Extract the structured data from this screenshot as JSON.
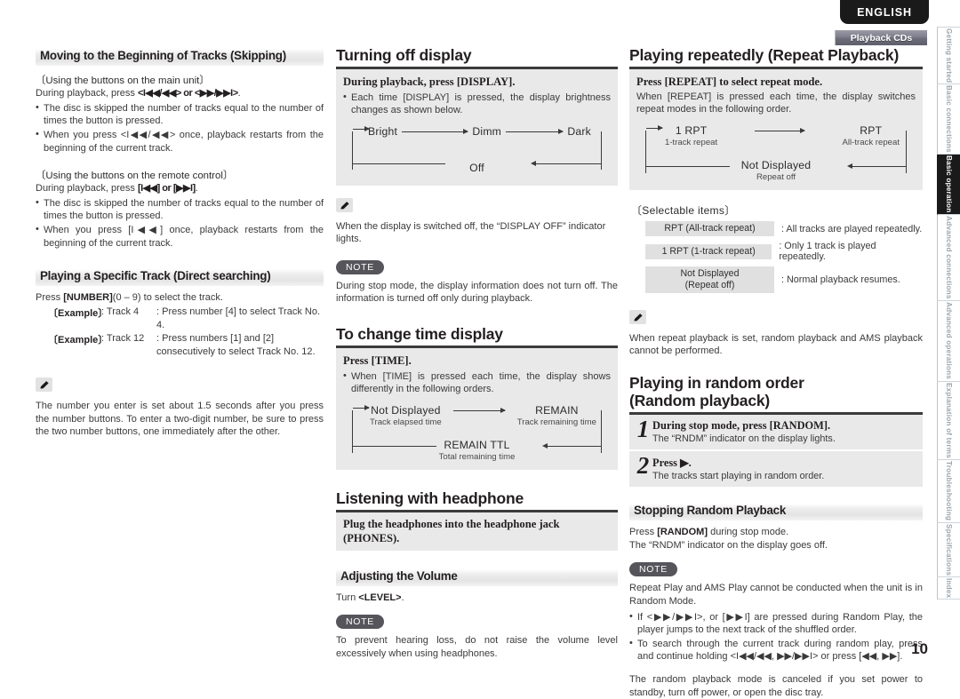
{
  "banner": {
    "language": "ENGLISH",
    "chapter": "Playback CDs",
    "page_number": "10"
  },
  "tabs": [
    {
      "label": "Getting started",
      "active": false
    },
    {
      "label": "Basic connections",
      "active": false
    },
    {
      "label": "Basic operation",
      "active": true
    },
    {
      "label": "Advanced connections",
      "active": false
    },
    {
      "label": "Advanced operations",
      "active": false
    },
    {
      "label": "Explanation of terms",
      "active": false
    },
    {
      "label": "Troubleshooting",
      "active": false
    },
    {
      "label": "Specifications",
      "active": false
    },
    {
      "label": "Index",
      "active": false
    }
  ],
  "column1": {
    "skipping": {
      "heading": "Moving to the Beginning of Tracks (Skipping)",
      "group_main_unit": {
        "label": "〔Using the buttons on the main unit〕",
        "instruction_prefix": "During playback, press ",
        "instruction_keys": "<I◀◀/◀◀> or <▶▶/▶▶I>",
        "instruction_suffix": ".",
        "bullets": [
          "The disc is skipped the number of tracks equal to the number of times the button is pressed.",
          "When you press <I◀◀/◀◀> once, playback restarts from the beginning of the current track."
        ]
      },
      "group_remote": {
        "label": "〔Using the buttons on the remote control〕",
        "instruction_prefix": "During playback, press ",
        "instruction_keys": "[I◀◀] or [▶▶I]",
        "instruction_suffix": ".",
        "bullets": [
          "The disc is skipped the number of tracks equal to the number of times the button is pressed.",
          "When you press [I◀◀] once, playback restarts from the beginning of the current track."
        ]
      }
    },
    "direct_search": {
      "heading": "Playing a Specific Track (Direct searching)",
      "lead_prefix": "Press ",
      "lead_key": "[NUMBER]",
      "lead_range": "(0 – 9)",
      "lead_suffix": " to select the track.",
      "examples": [
        {
          "label": "〔Example〕",
          "track": ": Track 4",
          "desc": ": Press number [4] to select Track No. 4."
        },
        {
          "label": "〔Example〕",
          "track": ": Track 12",
          "desc": ": Press numbers [1] and [2] consecutively to select Track No. 12."
        }
      ],
      "tip_icon": "pencil-icon",
      "tip": "The number you enter is set about 1.5 seconds after you press the number buttons. To enter a two-digit number, be sure to press the two number buttons, one immediately after the other."
    }
  },
  "column2": {
    "turning_off_display": {
      "heading": "Turning off display",
      "lead": "During playback, press [DISPLAY].",
      "bullet": "Each time [DISPLAY] is pressed, the display brightness changes as shown below.",
      "cycle": {
        "nodes": [
          "Bright",
          "Dimm",
          "Dark",
          "Off"
        ],
        "sub": [
          "",
          "",
          "",
          ""
        ]
      },
      "tip_icon": "pencil-icon",
      "tip": "When the display is switched off, the “DISPLAY OFF” indicator lights.",
      "note_label": "NOTE",
      "note": "During stop mode, the display information does not turn off. The information is turned off only during playback."
    },
    "time_display": {
      "heading": "To change time display",
      "lead": "Press [TIME].",
      "bullet": "When [TIME] is pressed each time, the display shows differently in the following orders.",
      "cycle": {
        "nodes": [
          "Not Displayed",
          "REMAIN",
          "REMAIN  TTL"
        ],
        "sub": [
          "Track elapsed time",
          "Track remaining time",
          "Total remaining time"
        ]
      }
    },
    "headphone": {
      "heading": "Listening with headphone",
      "lead": "Plug the headphones into the headphone jack (PHONES).",
      "volume_heading": "Adjusting the Volume",
      "volume_text_prefix": "Turn ",
      "volume_text_key": "<LEVEL>",
      "volume_text_suffix": ".",
      "note_label": "NOTE",
      "note": "To prevent hearing loss, do not raise the volume level excessively when using headphones."
    }
  },
  "column3": {
    "repeat": {
      "heading": "Playing repeatedly (Repeat Playback)",
      "lead": "Press [REPEAT] to select repeat mode.",
      "body": "When [REPEAT] is pressed each time, the display switches repeat modes in the following order.",
      "cycle": {
        "nodes": [
          "1 RPT",
          "RPT",
          "Not Displayed"
        ],
        "sub": [
          "1-track repeat",
          "All-track repeat",
          "Repeat off"
        ]
      },
      "selectable_title": "〔Selectable items〕",
      "selectable_items": [
        {
          "key": "RPT (All-track repeat)",
          "key2": "",
          "value": ": All tracks are played repeatedly."
        },
        {
          "key": "1 RPT (1-track repeat)",
          "key2": "",
          "value": ": Only 1 track is played repeatedly."
        },
        {
          "key": "Not Displayed",
          "key2": "(Repeat off)",
          "value": ": Normal playback resumes."
        }
      ],
      "tip_icon": "pencil-icon",
      "tip": "When repeat playback is set, random playback and AMS playback cannot be performed."
    },
    "random": {
      "heading_line1": "Playing in random order",
      "heading_line2": "(Random playback)",
      "steps": [
        {
          "num": "1",
          "title": "During stop mode, press [RANDOM].",
          "desc": "The “RNDM” indicator on the display lights."
        },
        {
          "num": "2",
          "title": "Press ▶.",
          "desc": "The tracks start playing in random order."
        }
      ],
      "stopping_heading": "Stopping Random Playback",
      "stopping_line1_prefix": "Press ",
      "stopping_line1_key": "[RANDOM]",
      "stopping_line1_suffix": " during stop mode.",
      "stopping_line2": "The “RNDM” indicator on the display goes off.",
      "note_label": "NOTE",
      "note": "Repeat Play and AMS Play cannot be conducted when the unit is in Random Mode.",
      "bullets": [
        "If <▶▶/▶▶I>, or [▶▶I] are pressed during Random Play, the player jumps to the next track of the shuffled order.",
        "To search through the current track during random play, press and continue holding <I◀◀/◀◀, ▶▶/▶▶I> or press [◀◀, ▶▶]."
      ],
      "closing": "The random playback mode is canceled if you set power to standby, turn off power, or open the disc tray."
    }
  }
}
